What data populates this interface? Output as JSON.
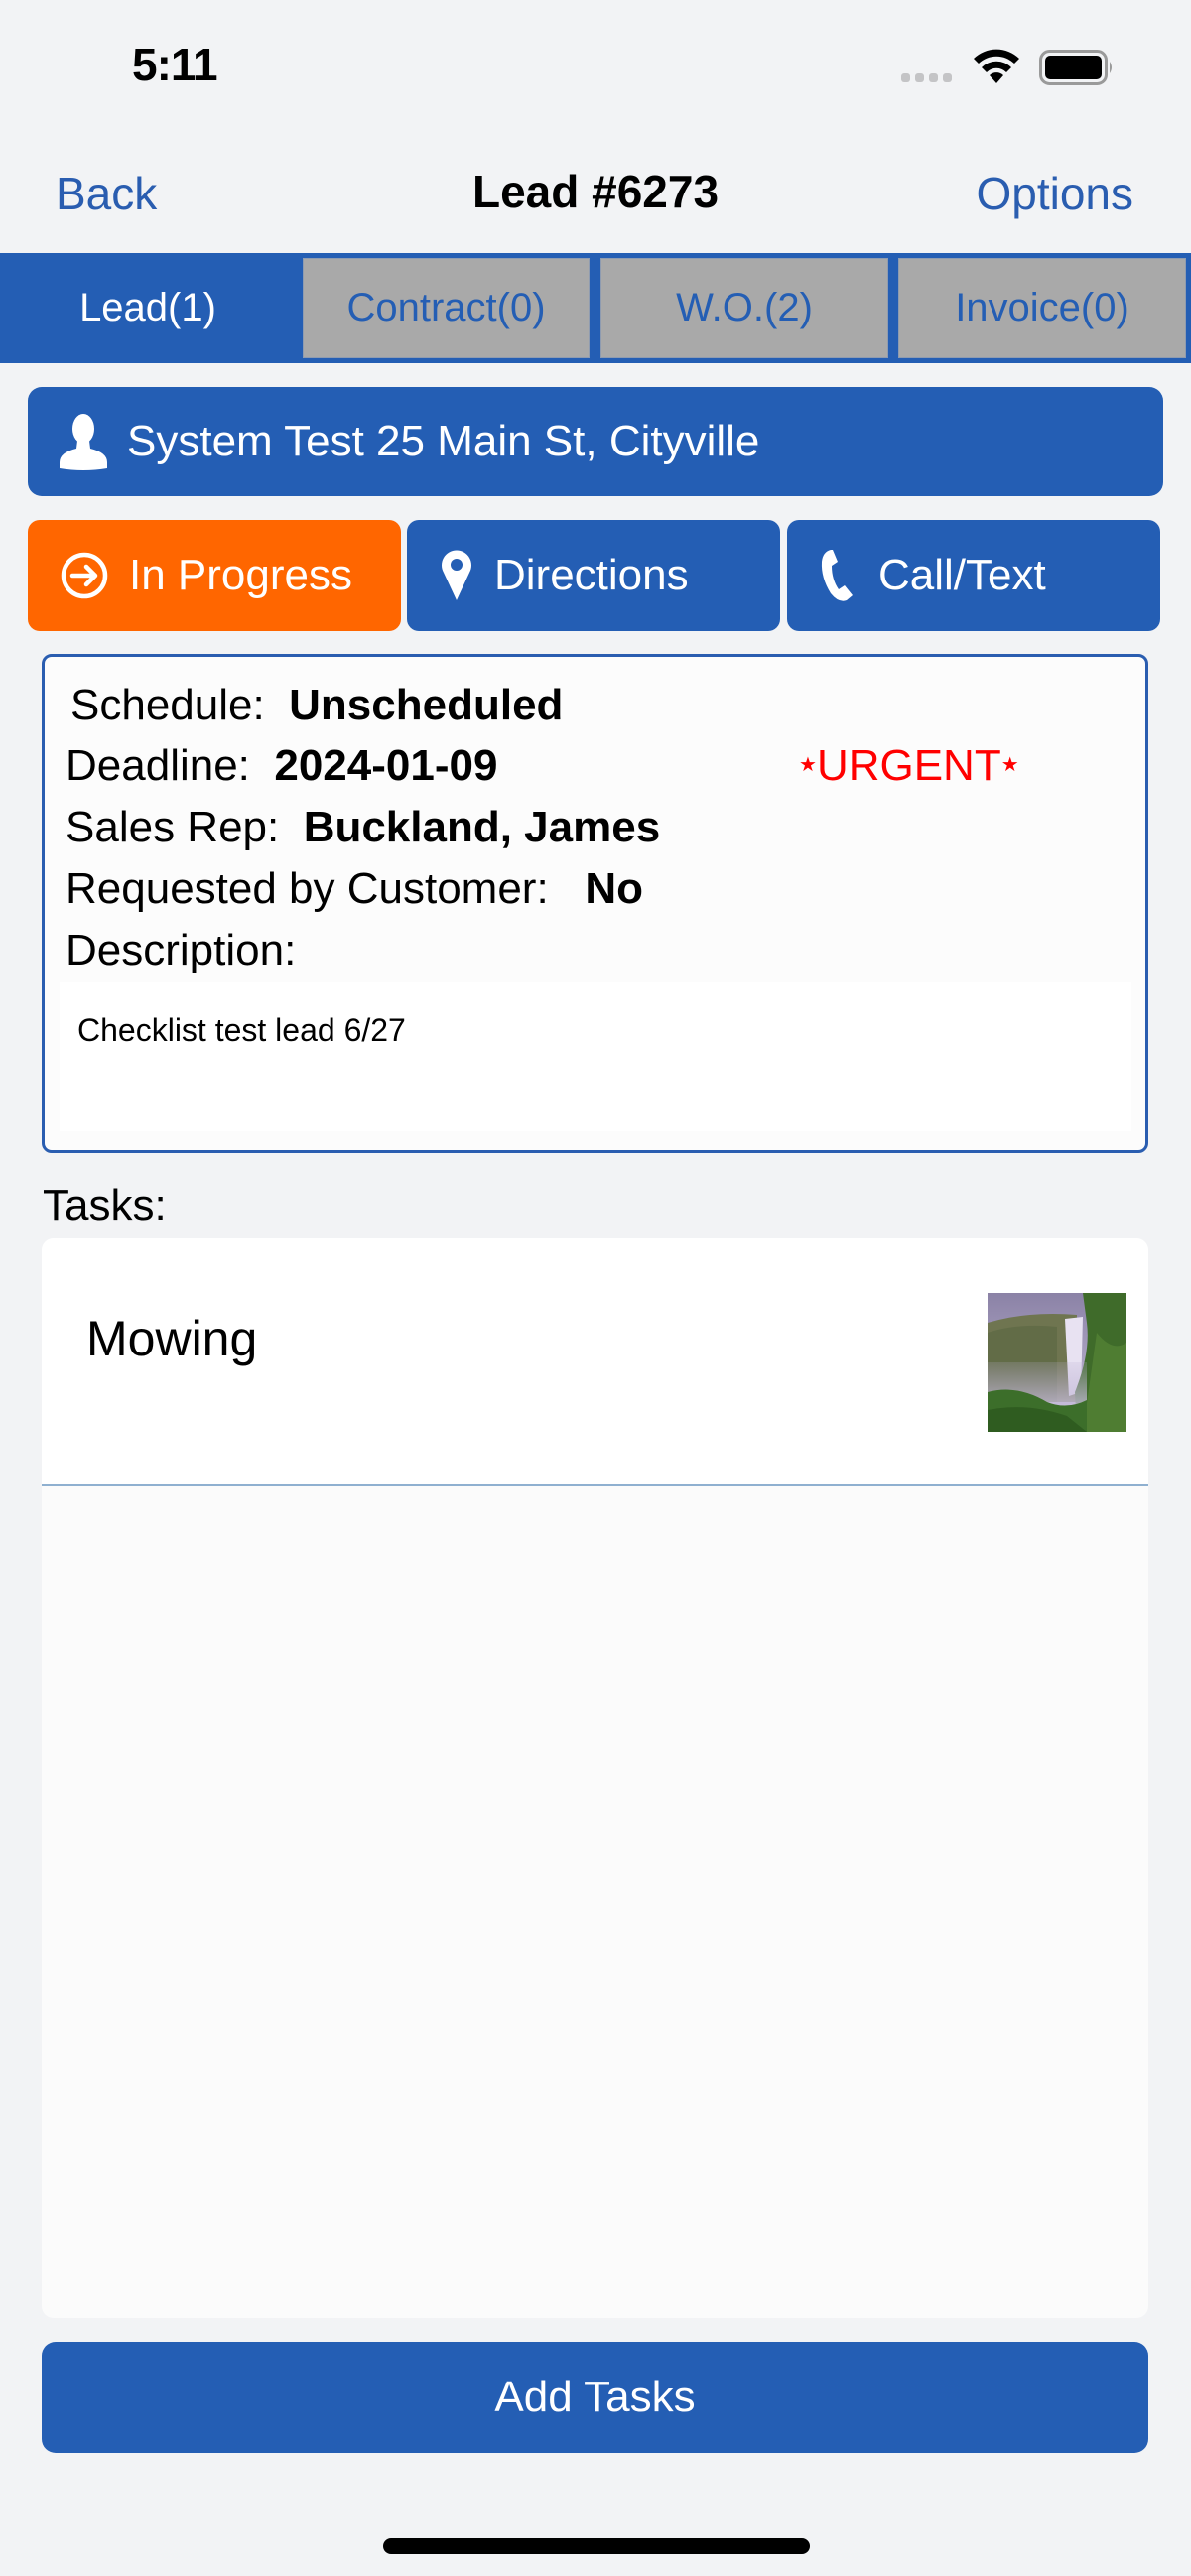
{
  "status_bar": {
    "time": "5:11"
  },
  "nav": {
    "back_label": "Back",
    "title": "Lead #6273",
    "options_label": "Options"
  },
  "tabs": [
    {
      "label": "Lead(1)",
      "active": true
    },
    {
      "label": "Contract(0)",
      "active": false
    },
    {
      "label": "W.O.(2)",
      "active": false
    },
    {
      "label": "Invoice(0)",
      "active": false
    }
  ],
  "customer": {
    "icon": "person-icon",
    "text": "System Test 25 Main St, Cityville"
  },
  "actions": {
    "status": {
      "label": "In Progress",
      "icon": "arrow-circle-right-icon",
      "color": "#ff6600"
    },
    "directions": {
      "label": "Directions",
      "icon": "map-pin-icon",
      "color": "#245eb4"
    },
    "call": {
      "label": "Call/Text",
      "icon": "phone-icon",
      "color": "#245eb4"
    }
  },
  "info": {
    "schedule_label": "Schedule:",
    "schedule_value": "Unscheduled",
    "deadline_label": "Deadline:",
    "deadline_value": "2024-01-09",
    "urgent_label": "URGENT",
    "sales_rep_label": "Sales Rep:",
    "sales_rep_value": "Buckland, James",
    "requested_label": "Requested by Customer:",
    "requested_value": "No",
    "description_label": "Description:",
    "description_value": "Checklist test lead 6/27"
  },
  "tasks": {
    "label": "Tasks:",
    "items": [
      {
        "name": "Mowing",
        "thumbnail": "waterfall-photo"
      }
    ],
    "add_label": "Add Tasks"
  },
  "colors": {
    "primary": "#245eb4",
    "status_orange": "#ff6600",
    "urgent_red": "#ff0000",
    "inactive_tab": "#a9a9a9"
  }
}
